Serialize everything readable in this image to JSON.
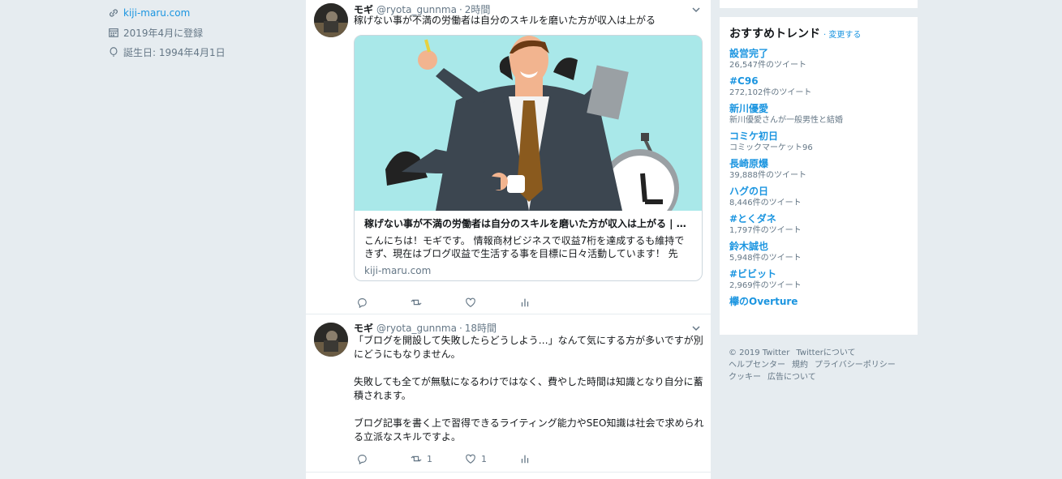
{
  "profile": {
    "website": "kiji-maru.com",
    "joined": "2019年4月に登録",
    "birthday": "誕生日: 1994年4月1日"
  },
  "tweets": [
    {
      "name": "モギ",
      "handle": "@ryota_gunnma",
      "time": "2時間",
      "text": [
        "稼げない事が不満の労働者は自分のスキルを磨いた方が収入は上がる"
      ],
      "card": {
        "title": "稼げない事が不満の労働者は自分のスキルを磨いた方が収入は上がる | き...",
        "description": "こんにちは！モギです。 情報商材ビジネスで収益7桁を達成するも維持できず、現在はブログ収益で生活する事を目標に日々活動しています！ 先日...",
        "domain": "kiji-maru.com"
      },
      "retweets": "",
      "likes": ""
    },
    {
      "name": "モギ",
      "handle": "@ryota_gunnma",
      "time": "18時間",
      "text": [
        "「ブログを開設して失敗したらどうしよう…」なんて気にする方が多いですが別にどうにもなりません。",
        "失敗しても全てが無駄になるわけではなく、費やした時間は知識となり自分に蓄積されます。",
        "ブログ記事を書く上で習得できるライティング能力やSEO知識は社会で求められる立派なスキルですよ。"
      ],
      "retweets": "1",
      "likes": "1"
    }
  ],
  "trends": {
    "title": "おすすめトレンド",
    "change": "変更する",
    "items": [
      {
        "name": "設営完了",
        "meta": "26,547件のツイート"
      },
      {
        "name": "#C96",
        "meta": "272,102件のツイート"
      },
      {
        "name": "新川優愛",
        "meta": "新川優愛さんが一般男性と結婚"
      },
      {
        "name": "コミケ初日",
        "meta": "コミックマーケット96"
      },
      {
        "name": "長崎原爆",
        "meta": "39,888件のツイート"
      },
      {
        "name": "ハグの日",
        "meta": "8,446件のツイート"
      },
      {
        "name": "#とくダネ",
        "meta": "1,797件のツイート"
      },
      {
        "name": "鈴木誠也",
        "meta": "5,948件のツイート"
      },
      {
        "name": "#ビビット",
        "meta": "2,969件のツイート"
      },
      {
        "name": "欅のOverture",
        "meta": ""
      }
    ]
  },
  "footer": {
    "line1": [
      "© 2019 Twitter",
      "Twitterについて"
    ],
    "line2": [
      "ヘルプセンター",
      "規約",
      "プライバシーポリシー"
    ],
    "line3": [
      "クッキー",
      "広告について"
    ]
  },
  "colors": {
    "accent": "#1b95e0",
    "background": "#e6ecf0",
    "muted": "#657786"
  }
}
